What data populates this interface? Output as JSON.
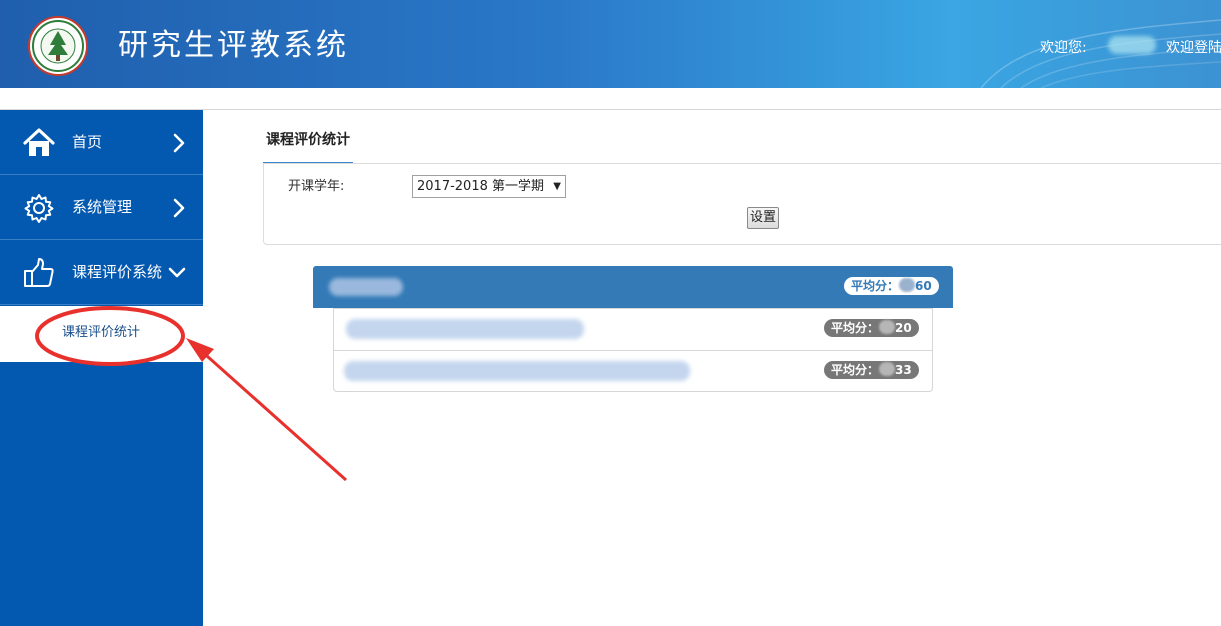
{
  "header": {
    "title": "研究生评教系统",
    "welcome_label": "欢迎您:",
    "welcome_message": "欢迎登陆!",
    "logo_icon": "university-seal-icon"
  },
  "sidebar": {
    "items": [
      {
        "label": "首页",
        "icon": "home-icon",
        "chevron": "chevron-right-icon"
      },
      {
        "label": "系统管理",
        "icon": "gear-icon",
        "chevron": "chevron-right-icon"
      },
      {
        "label": "课程评价系统",
        "icon": "thumbs-up-icon",
        "chevron": "chevron-down-icon"
      }
    ],
    "sub_items": [
      {
        "label": "课程评价统计",
        "selected": true
      }
    ]
  },
  "main": {
    "tab_label": "课程评价统计",
    "year_label": "开课学年:",
    "year_value": "2017-2018 第一学期",
    "set_button": "设置",
    "groups": [
      {
        "avg_label": "平均分：",
        "avg_suffix": "60",
        "items": [
          {
            "avg_label": "平均分：",
            "avg_suffix": "20"
          },
          {
            "avg_label": "平均分：",
            "avg_suffix": "33"
          }
        ]
      }
    ]
  },
  "colors": {
    "header_start": "#1f5fad",
    "header_end": "#3aa6e3",
    "sidebar": "#0358b0",
    "panel_head": "#337ab7",
    "badge_dark": "#777777",
    "annotation": "#e8302c"
  }
}
